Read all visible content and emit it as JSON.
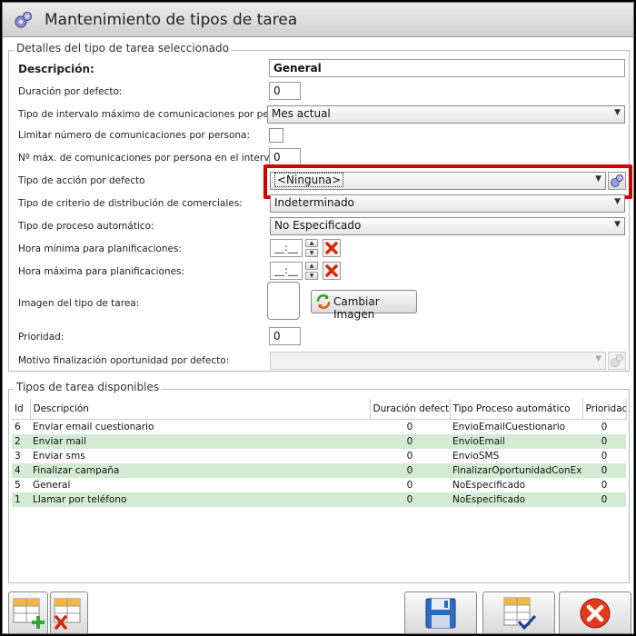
{
  "window": {
    "title": "Mantenimiento de tipos de tarea"
  },
  "details": {
    "group_title": "Detalles del tipo de tarea seleccionado",
    "descripcion": {
      "label": "Descripción:",
      "value": "General"
    },
    "duracion": {
      "label": "Duración por defecto:",
      "value": "0"
    },
    "tipo_intervalo": {
      "label": "Tipo de intervalo máximo de comunicaciones por persona:",
      "value": "Mes actual"
    },
    "limitar": {
      "label": "Limitar número de comunicaciones por persona:",
      "checked": false
    },
    "max_com": {
      "label": "Nº máx. de comunicaciones por persona en el intervalo:",
      "value": "0"
    },
    "tipo_accion": {
      "label": "Tipo de acción por defecto",
      "value": "<Ninguna>"
    },
    "criterio": {
      "label": "Tipo de criterio de distribución de comerciales:",
      "value": "Indeterminado"
    },
    "proceso": {
      "label": "Tipo de proceso automático:",
      "value": "No Especificado"
    },
    "hora_min": {
      "label": "Hora mínima para planificaciones:",
      "value": "__:__"
    },
    "hora_max": {
      "label": "Hora máxima para planificaciones:",
      "value": "__:__"
    },
    "imagen": {
      "label": "Imagen del tipo de tarea:",
      "button": "Cambiar Imagen"
    },
    "prioridad": {
      "label": "Prioridad:",
      "value": "0"
    },
    "motivo": {
      "label": "Motivo finalización oportunidad por defecto:",
      "value": ""
    }
  },
  "list": {
    "group_title": "Tipos de tarea disponibles",
    "columns": [
      "Id",
      "Descripción",
      "Duración defecto",
      "Tipo Proceso automático",
      "Prioridad"
    ],
    "rows": [
      {
        "id": "6",
        "descripcion": "Enviar email cuestionario",
        "duracion": "0",
        "proceso": "EnvioEmailCuestionario",
        "prioridad": "0"
      },
      {
        "id": "2",
        "descripcion": "Enviar mail",
        "duracion": "0",
        "proceso": "EnvioEmail",
        "prioridad": "0"
      },
      {
        "id": "3",
        "descripcion": "Enviar sms",
        "duracion": "0",
        "proceso": "EnvioSMS",
        "prioridad": "0"
      },
      {
        "id": "4",
        "descripcion": "Finalizar campaña",
        "duracion": "0",
        "proceso": "FinalizarOportunidadConExito",
        "prioridad": "0"
      },
      {
        "id": "5",
        "descripcion": "General",
        "duracion": "0",
        "proceso": "NoEspecificado",
        "prioridad": "0"
      },
      {
        "id": "1",
        "descripcion": "Llamar por teléfono",
        "duracion": "0",
        "proceso": "NoEspecificado",
        "prioridad": "0"
      }
    ]
  },
  "colors": {
    "highlight": "#d40000",
    "row_alt": "#d3ebd3"
  },
  "icons": [
    "gears-icon",
    "add-row-icon",
    "delete-row-icon",
    "save-icon",
    "accept-icon",
    "close-icon"
  ]
}
